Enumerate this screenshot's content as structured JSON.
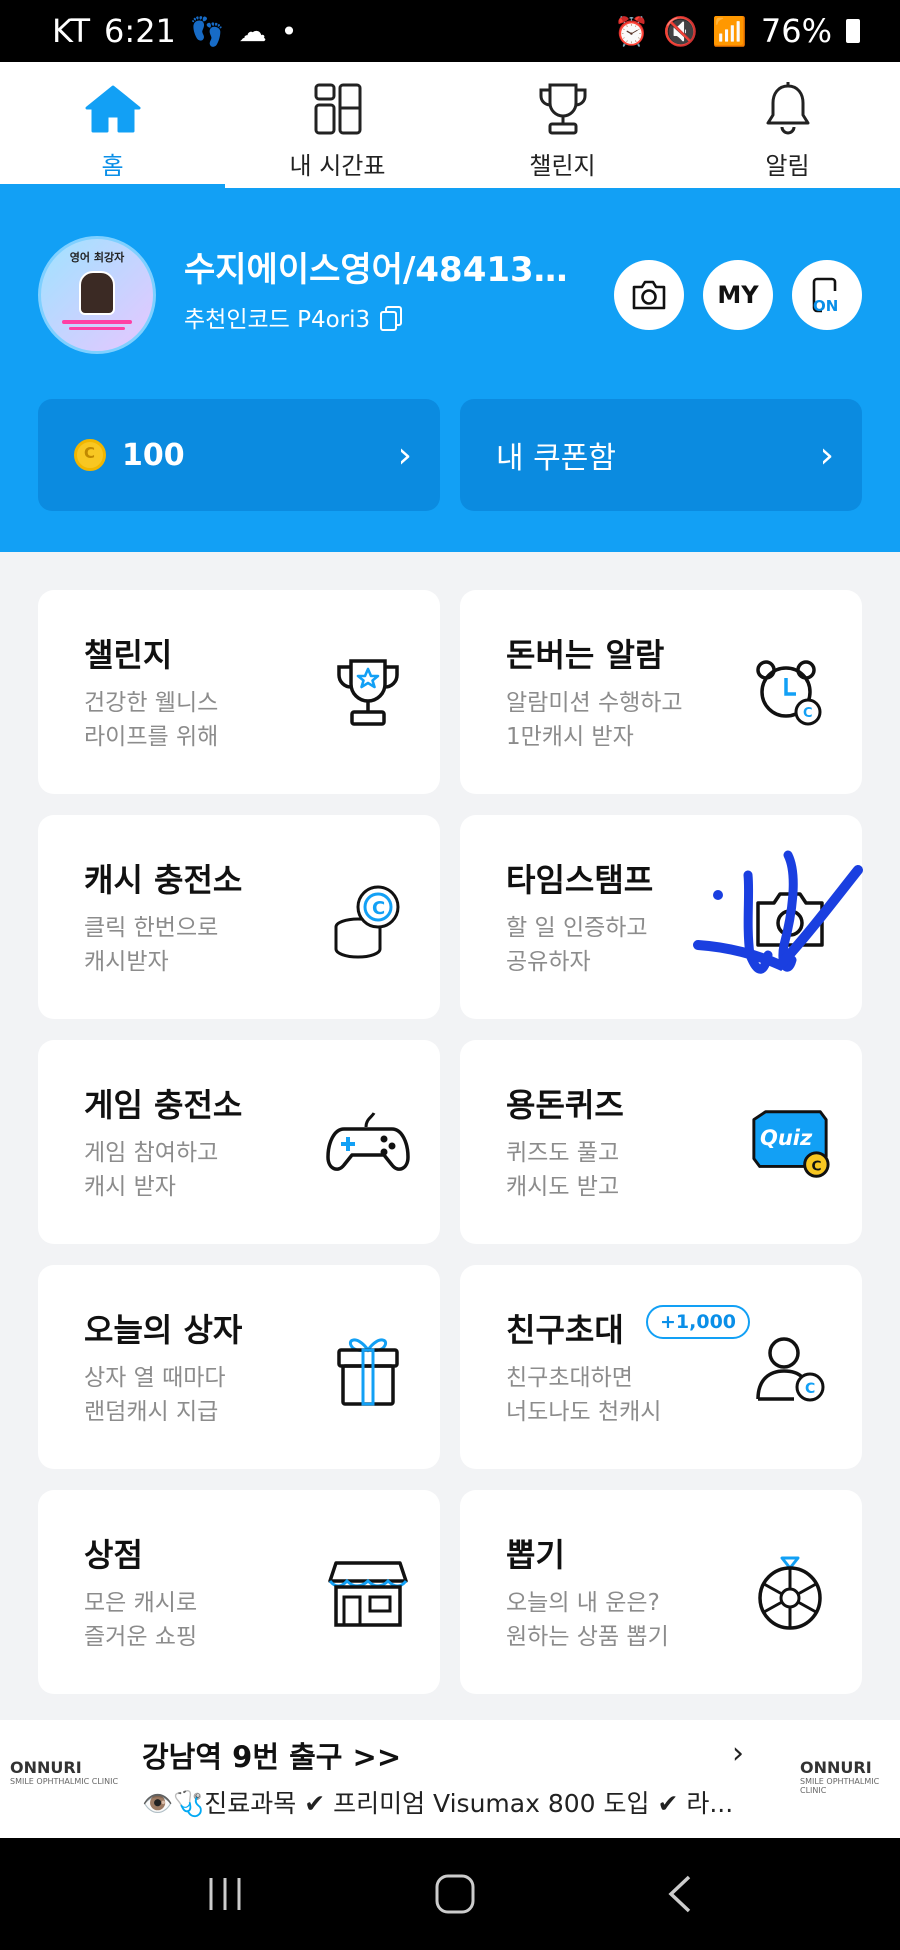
{
  "status_bar": {
    "carrier": "KT",
    "time": "6:21",
    "battery": "76%"
  },
  "tabs": [
    {
      "label": "홈",
      "icon": "home-icon",
      "active": true
    },
    {
      "label": "내 시간표",
      "icon": "timetable-icon",
      "active": false
    },
    {
      "label": "챌린지",
      "icon": "trophy-icon",
      "active": false
    },
    {
      "label": "알림",
      "icon": "bell-icon",
      "active": false
    }
  ],
  "profile": {
    "name": "수지에이스영어/484133…",
    "referral_code": "추천인코드 P4ori3",
    "avatar_title": "영어 최강자"
  },
  "header_buttons": {
    "my": "MY",
    "on": "ON"
  },
  "wallet": {
    "cash": "100",
    "coupon_label": "내 쿠폰함"
  },
  "cards": [
    {
      "title": "챌린지",
      "desc": [
        "건강한 웰니스",
        "라이프를 위해"
      ],
      "icon": "trophy-star-icon"
    },
    {
      "title": "돈버는 알람",
      "desc": [
        "알람미션 수행하고",
        "1만캐시 받자"
      ],
      "icon": "alarm-clock-icon"
    },
    {
      "title": "캐시 충전소",
      "desc": [
        "클릭 한번으로",
        "캐시받자"
      ],
      "icon": "coin-stack-icon"
    },
    {
      "title": "타임스탬프",
      "desc": [
        "할 일 인증하고",
        "공유하자"
      ],
      "icon": "camera-icon"
    },
    {
      "title": "게임 충전소",
      "desc": [
        "게임 참여하고",
        "캐시 받자"
      ],
      "icon": "gamepad-icon"
    },
    {
      "title": "용돈퀴즈",
      "desc": [
        "퀴즈도 풀고",
        "캐시도 받고"
      ],
      "icon": "quiz-icon",
      "icon_text": "Quiz"
    },
    {
      "title": "오늘의 상자",
      "desc": [
        "상자 열 때마다",
        "랜덤캐시 지급"
      ],
      "icon": "gift-box-icon"
    },
    {
      "title": "친구초대",
      "desc": [
        "친구초대하면",
        "너도나도 천캐시"
      ],
      "icon": "invite-friend-icon",
      "badge": "+1,000"
    },
    {
      "title": "상점",
      "desc": [
        "모은 캐시로",
        "즐거운 쇼핑"
      ],
      "icon": "store-icon"
    },
    {
      "title": "뽑기",
      "desc": [
        "오늘의 내 운은?",
        "원하는 상품 뽑기"
      ],
      "icon": "roulette-icon"
    }
  ],
  "ad": {
    "logo_text": "ONNURI",
    "logo_sub": "SMILE OPHTHALMIC CLINIC",
    "title": "강남역 9번 출구 >>",
    "subtitle": "👁️🩺진료과목 ✔ 프리미엄 Visumax 800 도입 ✔ 라..."
  },
  "colors": {
    "brand_blue": "#12a0f5",
    "pill_blue": "#0b8be0",
    "tab_active": "#0a8fe8"
  }
}
